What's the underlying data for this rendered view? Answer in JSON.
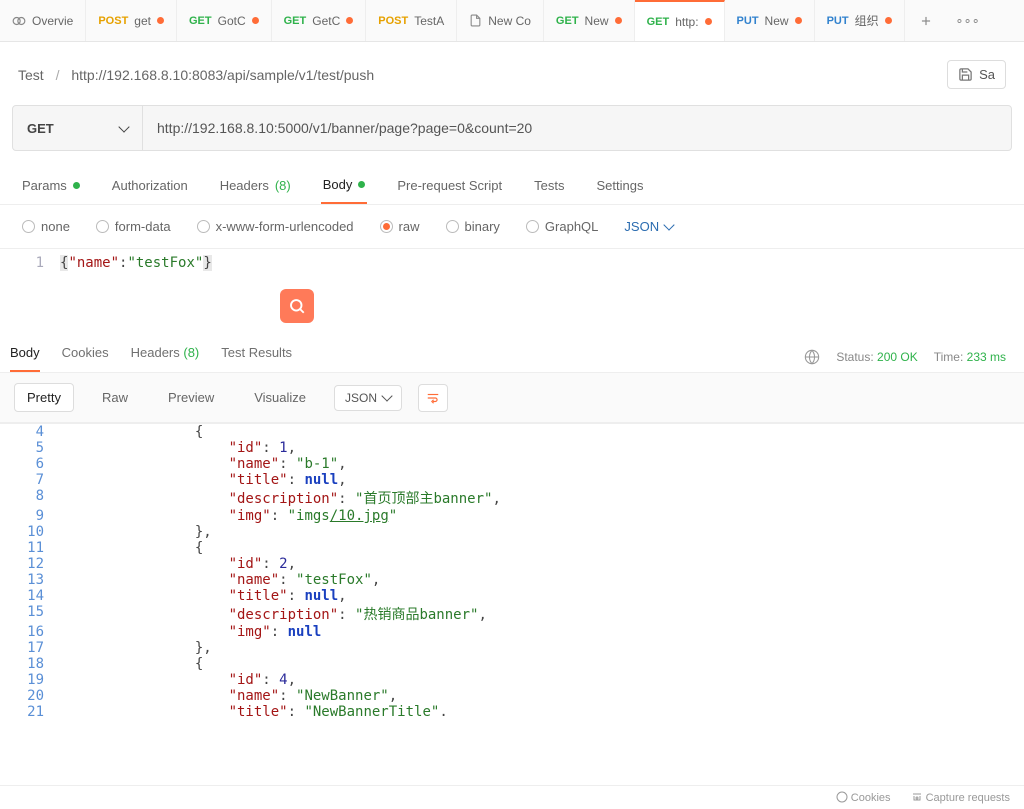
{
  "tabs": [
    {
      "method": "",
      "methodClass": "",
      "label": "Overvie",
      "dot": false,
      "icon": "overview"
    },
    {
      "method": "POST",
      "methodClass": "m-post",
      "label": "get",
      "dot": true
    },
    {
      "method": "GET",
      "methodClass": "m-get",
      "label": "GotC",
      "dot": true
    },
    {
      "method": "GET",
      "methodClass": "m-get",
      "label": "GetC",
      "dot": true
    },
    {
      "method": "POST",
      "methodClass": "m-post",
      "label": "TestA",
      "dot": false
    },
    {
      "method": "",
      "methodClass": "",
      "label": "New Co",
      "dot": false,
      "icon": "doc"
    },
    {
      "method": "GET",
      "methodClass": "m-get",
      "label": "New",
      "dot": true
    },
    {
      "method": "GET",
      "methodClass": "m-get",
      "label": "http:",
      "dot": true,
      "active": true
    },
    {
      "method": "PUT",
      "methodClass": "m-put",
      "label": "New",
      "dot": true
    },
    {
      "method": "PUT",
      "methodClass": "m-put",
      "label": "组织",
      "dot": true
    }
  ],
  "breadcrumb": {
    "root": "Test",
    "path": "http://192.168.8.10:8083/api/sample/v1/test/push"
  },
  "save_label": "Sa",
  "method": "GET",
  "url": "http://192.168.8.10:5000/v1/banner/page?page=0&count=20",
  "req_tabs": [
    {
      "label": "Params",
      "dot": true
    },
    {
      "label": "Authorization"
    },
    {
      "label": "Headers",
      "count": "(8)"
    },
    {
      "label": "Body",
      "dot": true,
      "active": true
    },
    {
      "label": "Pre-request Script"
    },
    {
      "label": "Tests"
    },
    {
      "label": "Settings"
    }
  ],
  "body_types": [
    {
      "label": "none"
    },
    {
      "label": "form-data"
    },
    {
      "label": "x-www-form-urlencoded"
    },
    {
      "label": "raw",
      "on": true
    },
    {
      "label": "binary"
    },
    {
      "label": "GraphQL"
    }
  ],
  "body_format": "JSON",
  "request_body_line": "1",
  "request_body_code": "{\"name\":\"testFox\"}",
  "resp_tabs": [
    {
      "label": "Body",
      "active": true
    },
    {
      "label": "Cookies"
    },
    {
      "label": "Headers",
      "count": "(8)"
    },
    {
      "label": "Test Results"
    }
  ],
  "status": {
    "label": "Status:",
    "code": "200 OK"
  },
  "time": {
    "label": "Time:",
    "value": "233 ms"
  },
  "view_modes": [
    {
      "label": "Pretty",
      "active": true
    },
    {
      "label": "Raw"
    },
    {
      "label": "Preview"
    },
    {
      "label": "Visualize"
    }
  ],
  "resp_format": "JSON",
  "response_lines": [
    {
      "n": 4,
      "indent": 8,
      "t": [
        {
          "p": "{"
        }
      ]
    },
    {
      "n": 5,
      "indent": 10,
      "t": [
        {
          "k": "\"id\""
        },
        {
          "p": ": "
        },
        {
          "num": "1"
        },
        {
          "p": ","
        }
      ]
    },
    {
      "n": 6,
      "indent": 10,
      "t": [
        {
          "k": "\"name\""
        },
        {
          "p": ": "
        },
        {
          "s": "\"b-1\""
        },
        {
          "p": ","
        }
      ]
    },
    {
      "n": 7,
      "indent": 10,
      "t": [
        {
          "k": "\"title\""
        },
        {
          "p": ": "
        },
        {
          "nul": "null"
        },
        {
          "p": ","
        }
      ]
    },
    {
      "n": 8,
      "indent": 10,
      "t": [
        {
          "k": "\"description\""
        },
        {
          "p": ": "
        },
        {
          "s": "\"首页顶部主banner\""
        },
        {
          "p": ","
        }
      ]
    },
    {
      "n": 9,
      "indent": 10,
      "t": [
        {
          "k": "\"img\""
        },
        {
          "p": ": "
        },
        {
          "s": "\"imgs"
        },
        {
          "url": "/10.jpg"
        },
        {
          "s": "\""
        }
      ]
    },
    {
      "n": 10,
      "indent": 8,
      "t": [
        {
          "p": "},"
        }
      ]
    },
    {
      "n": 11,
      "indent": 8,
      "t": [
        {
          "p": "{"
        }
      ]
    },
    {
      "n": 12,
      "indent": 10,
      "t": [
        {
          "k": "\"id\""
        },
        {
          "p": ": "
        },
        {
          "num": "2"
        },
        {
          "p": ","
        }
      ]
    },
    {
      "n": 13,
      "indent": 10,
      "t": [
        {
          "k": "\"name\""
        },
        {
          "p": ": "
        },
        {
          "s": "\"testFox\""
        },
        {
          "p": ","
        }
      ]
    },
    {
      "n": 14,
      "indent": 10,
      "t": [
        {
          "k": "\"title\""
        },
        {
          "p": ": "
        },
        {
          "nul": "null"
        },
        {
          "p": ","
        }
      ]
    },
    {
      "n": 15,
      "indent": 10,
      "t": [
        {
          "k": "\"description\""
        },
        {
          "p": ": "
        },
        {
          "s": "\"热销商品banner\""
        },
        {
          "p": ","
        }
      ]
    },
    {
      "n": 16,
      "indent": 10,
      "t": [
        {
          "k": "\"img\""
        },
        {
          "p": ": "
        },
        {
          "nul": "null"
        }
      ]
    },
    {
      "n": 17,
      "indent": 8,
      "t": [
        {
          "p": "},"
        }
      ]
    },
    {
      "n": 18,
      "indent": 8,
      "t": [
        {
          "p": "{"
        }
      ]
    },
    {
      "n": 19,
      "indent": 10,
      "t": [
        {
          "k": "\"id\""
        },
        {
          "p": ": "
        },
        {
          "num": "4"
        },
        {
          "p": ","
        }
      ]
    },
    {
      "n": 20,
      "indent": 10,
      "t": [
        {
          "k": "\"name\""
        },
        {
          "p": ": "
        },
        {
          "s": "\"NewBanner\""
        },
        {
          "p": ","
        }
      ]
    },
    {
      "n": 21,
      "indent": 10,
      "t": [
        {
          "k": "\"title\""
        },
        {
          "p": ": "
        },
        {
          "s": "\"NewBannerTitle\""
        },
        {
          "p": "."
        }
      ]
    }
  ],
  "footer": {
    "cookies": "Cookies",
    "capture": "Capture requests"
  }
}
